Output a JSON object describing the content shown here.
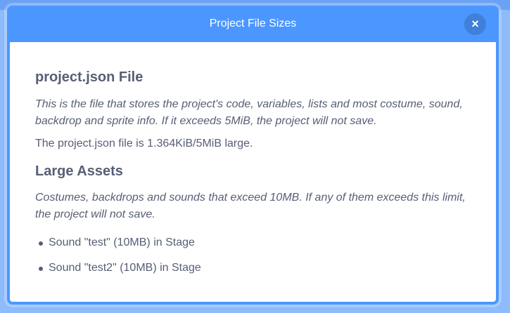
{
  "modal": {
    "title": "Project File Sizes",
    "close_icon": "close-icon",
    "close_glyph": "×"
  },
  "json_section": {
    "heading": "project.json File",
    "description": "This is the file that stores the project's code, variables, lists and most costume, sound, backdrop and sprite info. If it exceeds 5MiB, the project will not save.",
    "size_text": "The project.json file is 1.364KiB/5MiB large."
  },
  "assets_section": {
    "heading": "Large Assets",
    "description": "Costumes, backdrops and sounds that exceed 10MB. If any of them exceeds this limit, the project will not save.",
    "items": [
      {
        "text": "Sound \"test\" (10MB) in Stage"
      },
      {
        "text": "Sound \"test2\" (10MB) in Stage"
      }
    ]
  },
  "colors": {
    "header": "#4c97ff",
    "text": "#575e75",
    "body_bg": "#ffffff"
  }
}
